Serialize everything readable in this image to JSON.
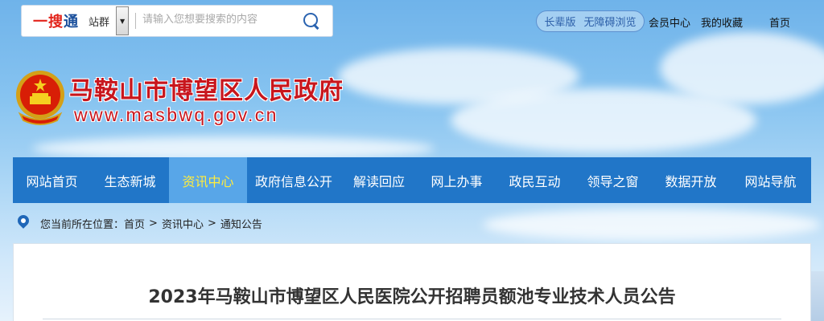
{
  "top": {
    "brand_main": "一搜",
    "brand_accent": "通",
    "site_group": "站群",
    "search_placeholder": "请输入您想要搜索的内容",
    "access_elder": "长辈版",
    "access_barrier_free": "无障碍浏览",
    "member_center": "会员中心",
    "my_favorites": "我的收藏",
    "home": "首页"
  },
  "header": {
    "title": "马鞍山市博望区人民政府",
    "url": "www.masbwq.gov.cn"
  },
  "nav": {
    "items": [
      {
        "label": "网站首页"
      },
      {
        "label": "生态新城"
      },
      {
        "label": "资讯中心",
        "active": true
      },
      {
        "label": "政府信息公开"
      },
      {
        "label": "解读回应"
      },
      {
        "label": "网上办事"
      },
      {
        "label": "政民互动"
      },
      {
        "label": "领导之窗"
      },
      {
        "label": "数据开放"
      },
      {
        "label": "网站导航"
      }
    ]
  },
  "breadcrumb": {
    "prefix": "您当前所在位置：",
    "items": [
      "首页",
      "资讯中心",
      "通知公告"
    ],
    "separator": ">"
  },
  "article": {
    "title": "2023年马鞍山市博望区人民医院公开招聘员额池专业技术人员公告"
  },
  "colors": {
    "nav_bg": "#2176c8",
    "nav_active_bg": "#58a6e8",
    "nav_active_text": "#ffec3d",
    "title_red": "#c8161d"
  }
}
